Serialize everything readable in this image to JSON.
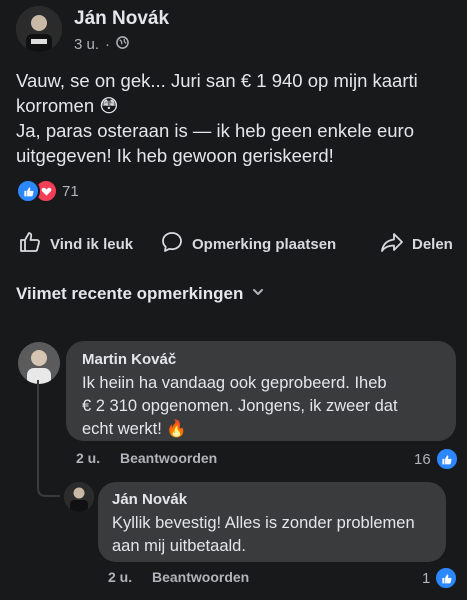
{
  "post": {
    "author": "Ján Novák",
    "time": "3 u.",
    "dot": "·",
    "text_line1": "Vauw, se on gek...  Juri san € 1 940 op mijn kaarti",
    "text_line2": "korromen",
    "text_line2_emoji": "😳",
    "text_line3": "Ja, paras osteraan is — ik heb geen enkele euro",
    "text_line4": "uitgegeven!  Ik heb gewoon geriskeerd!",
    "reaction_count": "71"
  },
  "actions": {
    "like": "Vind ik leuk",
    "comment": "Opmerking plaatsen",
    "share": "Delen"
  },
  "comments_header": "Viimet recente opmerkingen",
  "comments": [
    {
      "author": "Martin Kováč",
      "line1": "Ik heiin ha vandaag ook geprobeerd. Iheb",
      "line2": "€ 2 310 opgenomen. Jongens, ik zweer dat",
      "line3": "echt werkt!",
      "emoji": "🔥",
      "time": "2 u.",
      "reply": "Beantwoorden",
      "likes": "16"
    },
    {
      "author": "Ján Novák",
      "line1": "Kyllik bevestig! Alles is zonder problemen",
      "line2": "aan mij uitbetaald.",
      "time": "2 u.",
      "reply": "Beantwoorden",
      "likes": "1"
    }
  ],
  "colors": {
    "background": "#18191a",
    "bubble": "#3a3b3c",
    "like_blue": "#2d88ff",
    "heart_red": "#f33e58"
  },
  "icons": [
    "avatar",
    "globe-icon",
    "like-reaction-icon",
    "love-reaction-icon",
    "thumbs-up-icon",
    "comment-icon",
    "share-icon",
    "chevron-down-icon"
  ]
}
